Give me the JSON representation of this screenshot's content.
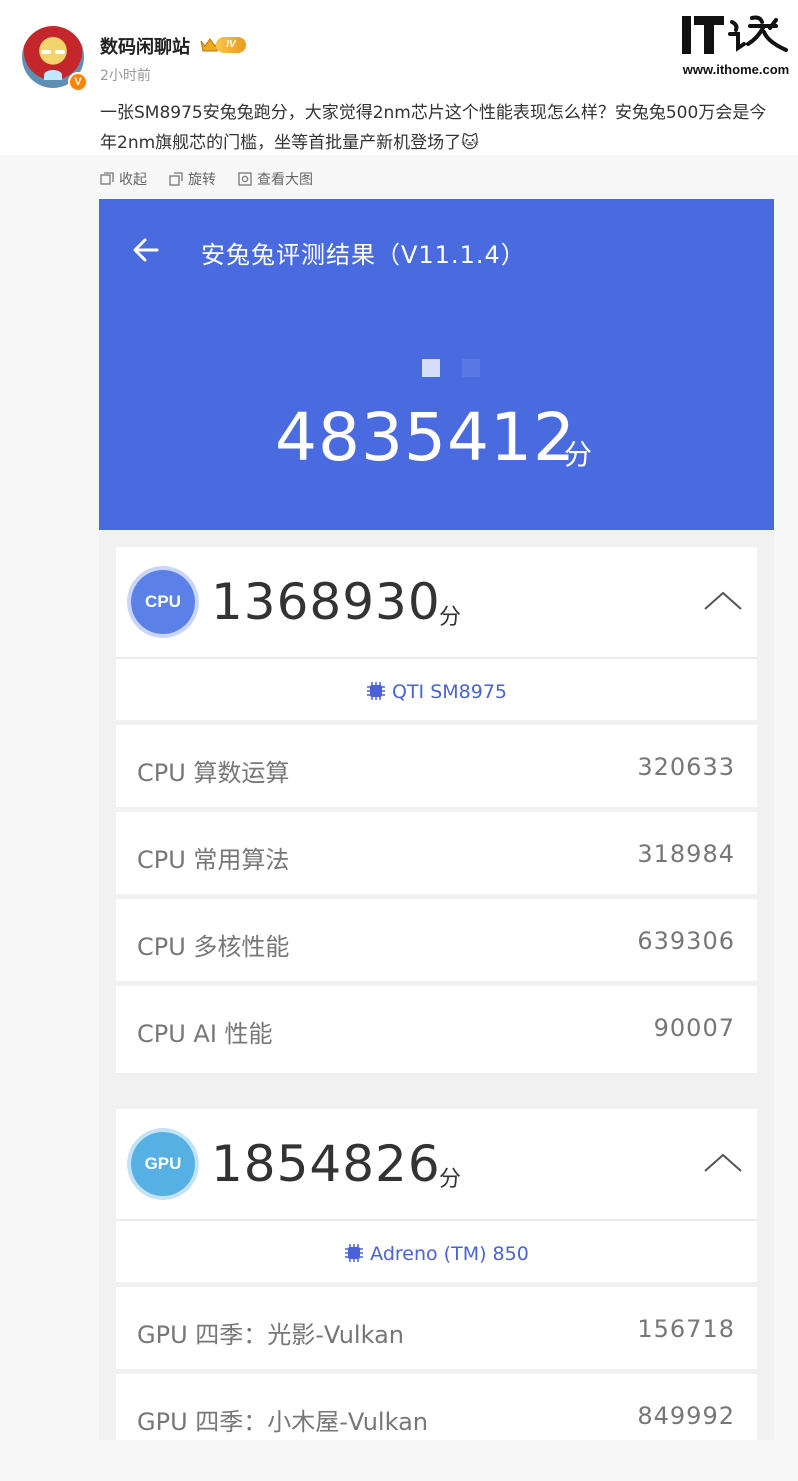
{
  "post": {
    "username": "数码闲聊站",
    "level": "IV",
    "verified_badge": "V",
    "timestamp": "2小时前",
    "text": "一张SM8975安兔兔跑分，大家觉得2nm芯片这个性能表现怎么样？安兔兔500万会是今年2nm旗舰芯的门槛，坐等首批量产新机登场了🐱"
  },
  "watermark": {
    "site": "www.ithome.com",
    "logo_text": "IT之家"
  },
  "toolbar": {
    "collapse": "收起",
    "rotate": "旋转",
    "view_large": "查看大图"
  },
  "benchmark": {
    "title": "安兔兔评测结果（V11.1.4）",
    "total_score": "4835412",
    "unit": "分",
    "cpu": {
      "badge": "CPU",
      "score": "1368930",
      "chip": "QTI SM8975",
      "rows": [
        {
          "label": "CPU 算数运算",
          "value": "320633"
        },
        {
          "label": "CPU 常用算法",
          "value": "318984"
        },
        {
          "label": "CPU 多核性能",
          "value": "639306"
        },
        {
          "label": "CPU AI 性能",
          "value": "90007"
        }
      ]
    },
    "gpu": {
      "badge": "GPU",
      "score": "1854826",
      "chip": "Adreno (TM) 850",
      "rows": [
        {
          "label": "GPU 四季：光影-Vulkan",
          "value": "156718"
        },
        {
          "label": "GPU 四季：小木屋-Vulkan",
          "value": "849992"
        }
      ]
    }
  },
  "colors": {
    "header_blue": "#4a6be0",
    "cpu_circle": "#5b81e8",
    "gpu_circle": "#56b0e4",
    "chip_text": "#4a62d8"
  }
}
